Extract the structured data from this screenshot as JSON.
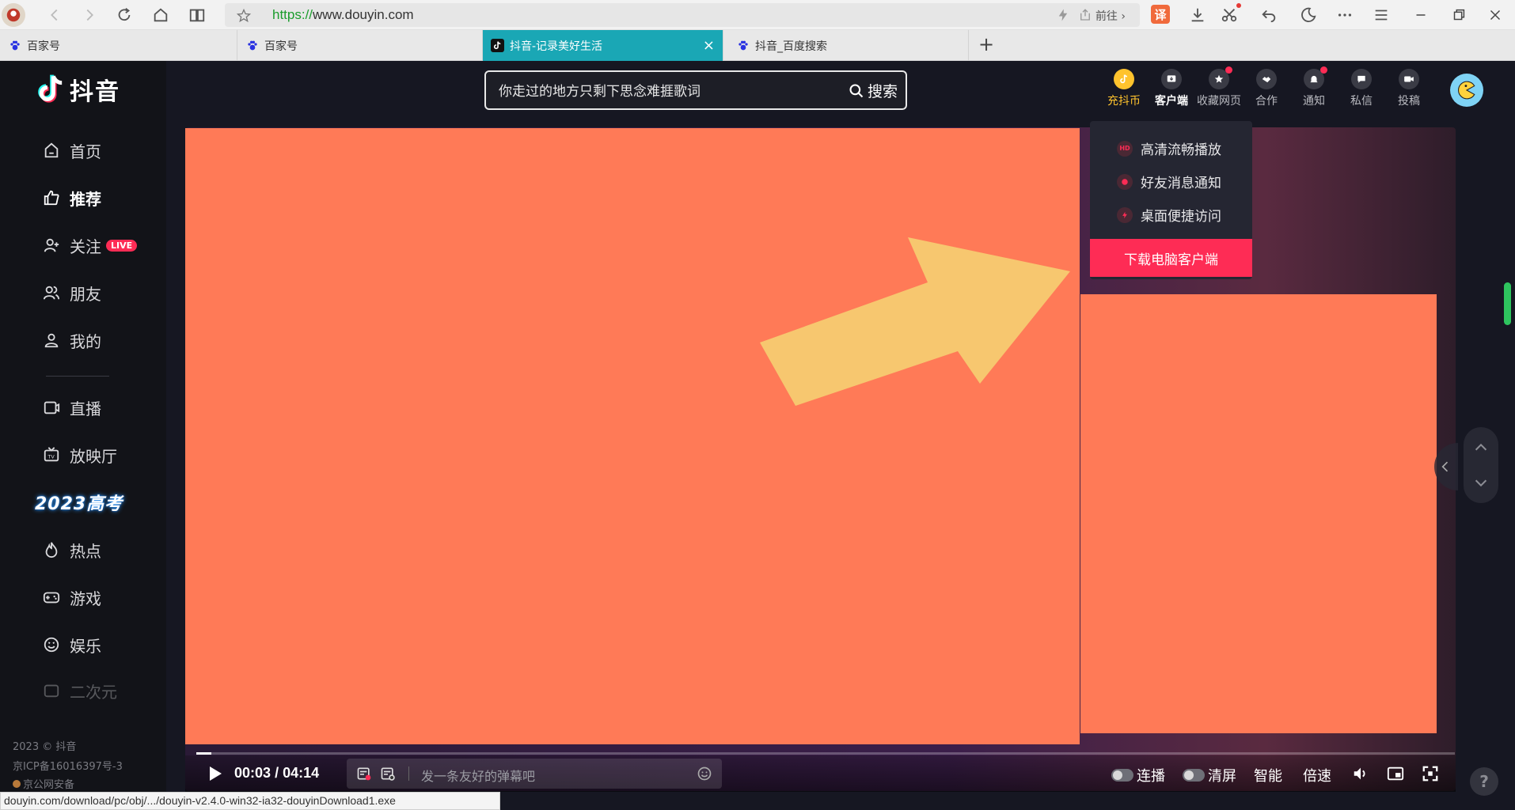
{
  "browser": {
    "url_scheme": "https://",
    "url_host": "www.douyin.com",
    "go_label": "前往",
    "translate_label": "译",
    "tabs": [
      {
        "title": "百家号"
      },
      {
        "title": "百家号"
      },
      {
        "title": "抖音-记录美好生活",
        "active": true
      },
      {
        "title": "抖音_百度搜索"
      }
    ],
    "new_tab": "+",
    "tab_close": "×",
    "status_url": "douyin.com/download/pc/obj/.../douyin-v2.4.0-win32-ia32-douyinDownload1.exe"
  },
  "sidebar": {
    "logo_text": "抖音",
    "items": [
      {
        "label": "首页",
        "icon": "home-icon"
      },
      {
        "label": "推荐",
        "icon": "thumbs-up-icon"
      },
      {
        "label": "关注",
        "icon": "user-plus-icon",
        "badge": "LIVE"
      },
      {
        "label": "朋友",
        "icon": "friends-icon"
      },
      {
        "label": "我的",
        "icon": "person-icon"
      },
      {
        "label": "直播",
        "icon": "live-icon"
      },
      {
        "label": "放映厅",
        "icon": "tv-icon"
      },
      {
        "label": "热点",
        "icon": "flame-icon"
      },
      {
        "label": "游戏",
        "icon": "gamepad-icon"
      },
      {
        "label": "娱乐",
        "icon": "smile-icon"
      },
      {
        "label": "二次元",
        "icon": "anime-icon"
      }
    ],
    "promo": "2023高考",
    "footer": [
      "2023 © 抖音",
      "京ICP备16016397号-3",
      "京公网安备"
    ]
  },
  "header": {
    "search_value": "你走过的地方只剩下思念难捱歌词",
    "search_button": "搜索",
    "items": [
      {
        "label": "充抖币",
        "icon": "coin-icon"
      },
      {
        "label": "客户端",
        "icon": "download-client-icon"
      },
      {
        "label": "收藏网页",
        "icon": "star-icon"
      },
      {
        "label": "合作",
        "icon": "handshake-icon"
      },
      {
        "label": "通知",
        "icon": "bell-icon"
      },
      {
        "label": "私信",
        "icon": "message-icon"
      },
      {
        "label": "投稿",
        "icon": "video-upload-icon"
      }
    ]
  },
  "dropdown": {
    "items": [
      {
        "label": "高清流畅播放",
        "icon_text": "HD"
      },
      {
        "label": "好友消息通知",
        "icon_text": ""
      },
      {
        "label": "桌面便捷访问",
        "icon_text": ""
      }
    ],
    "button": "下载电脑客户端"
  },
  "player": {
    "current_time": "00:03",
    "time_separator": "/",
    "duration": "04:14",
    "progress_fraction": 0.012,
    "danmu_placeholder": "发一条友好的弹幕吧",
    "autoplay_label": "连播",
    "clear_label": "清屏",
    "smart_label": "智能",
    "speed_label": "倍速"
  },
  "help_label": "?",
  "colors": {
    "accent": "#fe2c55",
    "redaction": "#ff7a57",
    "arrow": "#f7c76f",
    "active_tab": "#1aa7b5"
  }
}
